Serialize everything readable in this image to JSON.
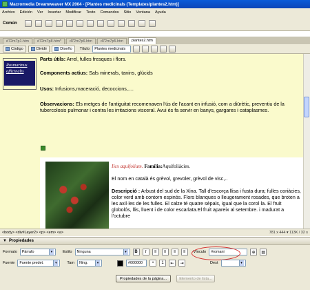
{
  "window": {
    "title": "Macromedia Dreamweaver MX 2004 - [Plantes medicinals (Templates/plantes2.htm)]"
  },
  "menu": [
    "Archivo",
    "Edición",
    "Ver",
    "Insertar",
    "Modificar",
    "Texto",
    "Comandos",
    "Sitio",
    "Ventana",
    "Ayuda"
  ],
  "insert_bar": {
    "category": "Común"
  },
  "doc_tabs": [
    "d72m7p1.htm",
    "d72m7p8.htm*",
    "d72m7p6.htm",
    "d72m7p5.htm",
    "plantes2.htm"
  ],
  "doc_toolbar": {
    "code_label": "Código",
    "split_label": "Dividir",
    "design_label": "Diseño",
    "title_label": "Título:",
    "title_value": "Plantes medicinals"
  },
  "document": {
    "latin_name": "Rosmarinus officinalis",
    "parts_label": "Parts útils:",
    "parts_value": "Arrel, fulles fresques i flors.",
    "components_label": "Components actius:",
    "components_value": "Sals minerals, tanins, glúcids",
    "usos_label": "Usos:",
    "usos_value": "Infusions,maceració, decoccions,....",
    "observ_label": "Observacions:",
    "observ_value": "Els metges de l'antiguitat recomenaven l'ús de l'acant en infusió, com a diürètic, preventiu de la tubercolosis pulmonar i contra les irritacions visceral. Avui és fa servir en banys, gargares i cataplasmes.",
    "plant2_latin": "Ilex aquifolium.",
    "plant2_family_label": "Família:",
    "plant2_family_value": "Aquifoliàcies.",
    "plant2_names": "El nom en català és grèvol, grevoler, grèvol de visc,..",
    "plant2_desc_label": "Descripció :",
    "plant2_desc_value": "Arbust del sud de la Xina. Tall d'escorça llisa i fusta dura; fulles coriàcies, color verd amb contorn espinós. Flors blanques o lleugerament rosades, que broten a les axil·les de les fulles. El calze té quatre sèpals, igual que la corol·la. El fruit globolós, llis, lluent i de color escarlata.El fruit apareix al setembre. i madurat a l'octubre"
  },
  "status": {
    "tags": "<body> <div#Layer2> <p> <em> <a>",
    "info": "781 x 444 ▾ 113K / 32 s"
  },
  "properties": {
    "header": "Propiedades",
    "format_label": "Formato",
    "format_value": "Párrafo",
    "style_label": "Estilo",
    "style_value": "Ninguna",
    "bold": "B",
    "italic": "I",
    "link_label": "Vínculo",
    "link_value": "#romani",
    "font_label": "Fuente",
    "font_value": "Fuente predet.",
    "size_label": "Tam",
    "size_value": "Ning.",
    "color_value": "#000000",
    "target_label": "Dest",
    "page_props_button": "Propiedades de la página...",
    "list_item_button": "Elemento de lista..."
  },
  "colors": {
    "doc_bg": "#fafacc",
    "highlight": "#d42a2a",
    "titlebar": "#0a5bd8"
  }
}
